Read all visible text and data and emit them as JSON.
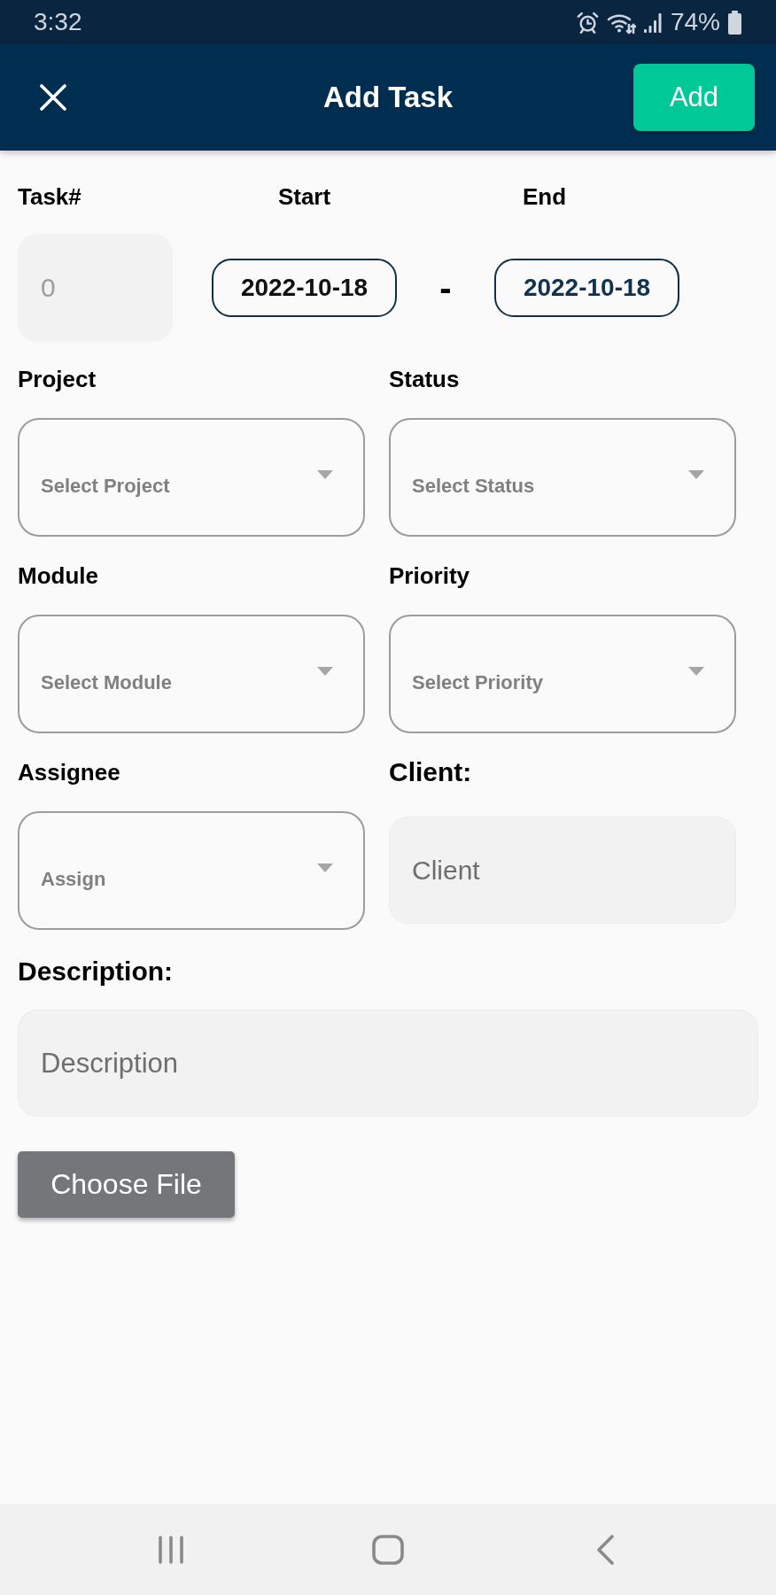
{
  "status_bar": {
    "time": "3:32",
    "battery": "74%"
  },
  "header": {
    "title": "Add Task",
    "action": "Add"
  },
  "task": {
    "label": "Task#",
    "placeholder": "0"
  },
  "dates": {
    "start_label": "Start",
    "end_label": "End",
    "start": "2022-10-18",
    "separator": "-",
    "end": "2022-10-18"
  },
  "fields": [
    {
      "kind": "dropdown",
      "label": "Project",
      "placeholder": "Select Project"
    },
    {
      "kind": "dropdown",
      "label": "Status",
      "placeholder": "Select Status"
    },
    {
      "kind": "dropdown",
      "label": "Module",
      "placeholder": "Select Module"
    },
    {
      "kind": "dropdown",
      "label": "Priority",
      "placeholder": "Select Priority"
    },
    {
      "kind": "dropdown",
      "label": "Assignee",
      "placeholder": "Assign"
    },
    {
      "kind": "text",
      "label": "Client:",
      "placeholder": "Client"
    }
  ],
  "description": {
    "label": "Description:",
    "placeholder": "Description"
  },
  "file_button": "Choose File"
}
